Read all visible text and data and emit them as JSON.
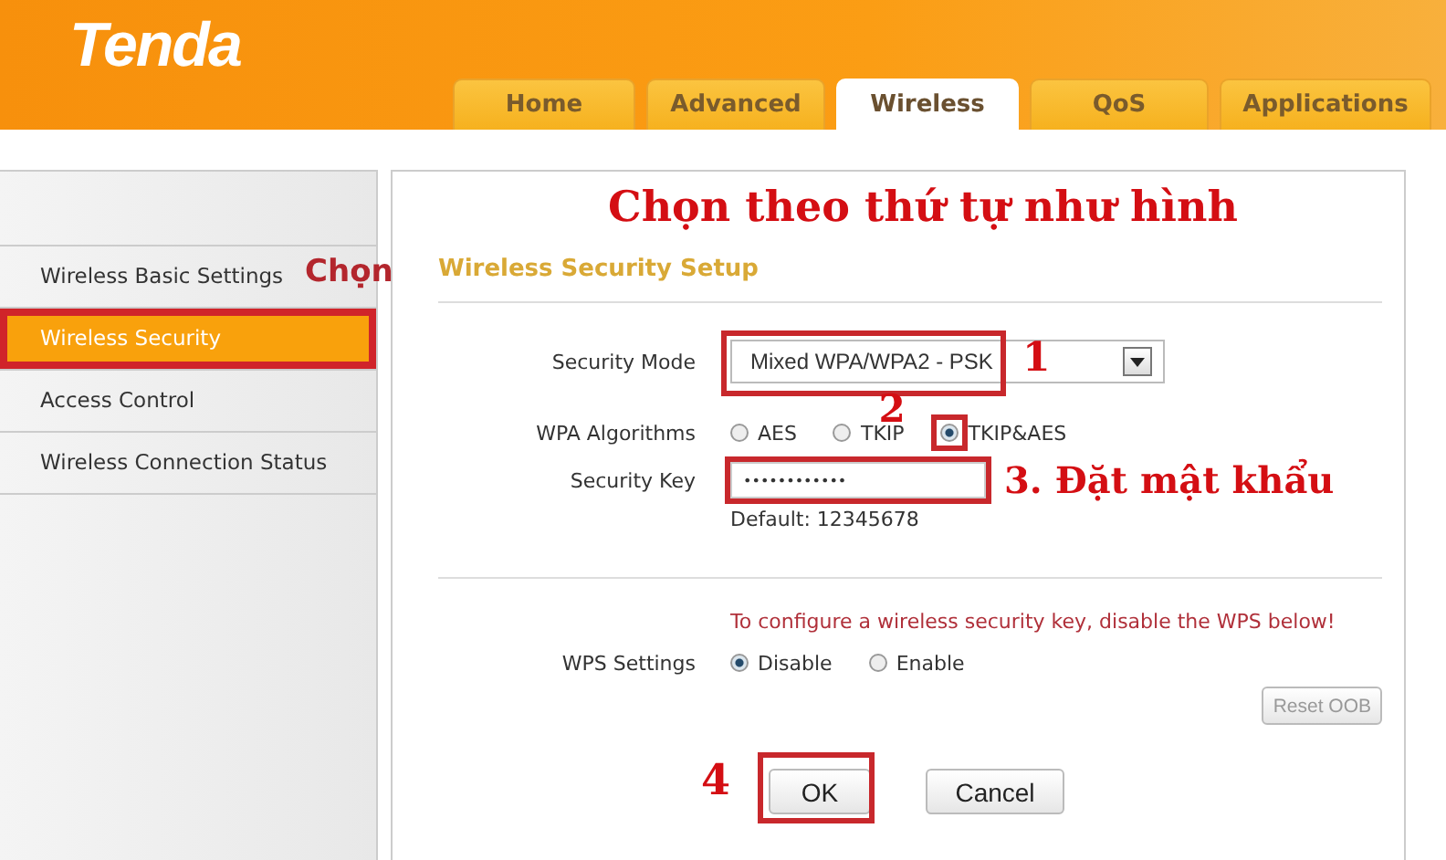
{
  "logo": "Tenda",
  "tabs": [
    {
      "label": "Home",
      "selected": false
    },
    {
      "label": "Advanced",
      "selected": false
    },
    {
      "label": "Wireless",
      "selected": true
    },
    {
      "label": "QoS",
      "selected": false
    },
    {
      "label": "Applications",
      "selected": false
    }
  ],
  "sidebar": {
    "note": "Chọn",
    "items": [
      {
        "label": "Wireless Basic Settings",
        "selected": false,
        "highlighted": false
      },
      {
        "label": "Wireless Security",
        "selected": true,
        "highlighted": true
      },
      {
        "label": "Access Control",
        "selected": false,
        "highlighted": false
      },
      {
        "label": "Wireless Connection Status",
        "selected": false,
        "highlighted": false
      }
    ]
  },
  "caption": "Chọn theo thứ tự như hình",
  "form": {
    "title": "Wireless Security Setup",
    "security_mode": {
      "label": "Security Mode",
      "value": "Mixed WPA/WPA2 - PSK",
      "highlighted": true,
      "step": "1"
    },
    "wpa_algorithms": {
      "label": "WPA Algorithms",
      "options": [
        {
          "label": "AES",
          "selected": false,
          "highlighted": false
        },
        {
          "label": "TKIP",
          "selected": false,
          "highlighted": false
        },
        {
          "label": "TKIP&AES",
          "selected": true,
          "highlighted": true,
          "step": "2"
        }
      ]
    },
    "security_key": {
      "label": "Security Key",
      "value": "••••••••••••",
      "highlighted": true,
      "step": "3. Đặt mật khẩu"
    },
    "default_hint": "Default: 12345678",
    "wps_notice": "To configure a wireless security key, disable the WPS below!",
    "wps_settings": {
      "label": "WPS Settings",
      "options": [
        {
          "label": "Disable",
          "selected": true
        },
        {
          "label": "Enable",
          "selected": false
        }
      ]
    },
    "reset_button": {
      "label": "Reset OOB",
      "disabled": true
    },
    "buttons": [
      {
        "label": "OK",
        "highlighted": true,
        "step": "4"
      },
      {
        "label": "Cancel",
        "highlighted": false
      }
    ]
  }
}
